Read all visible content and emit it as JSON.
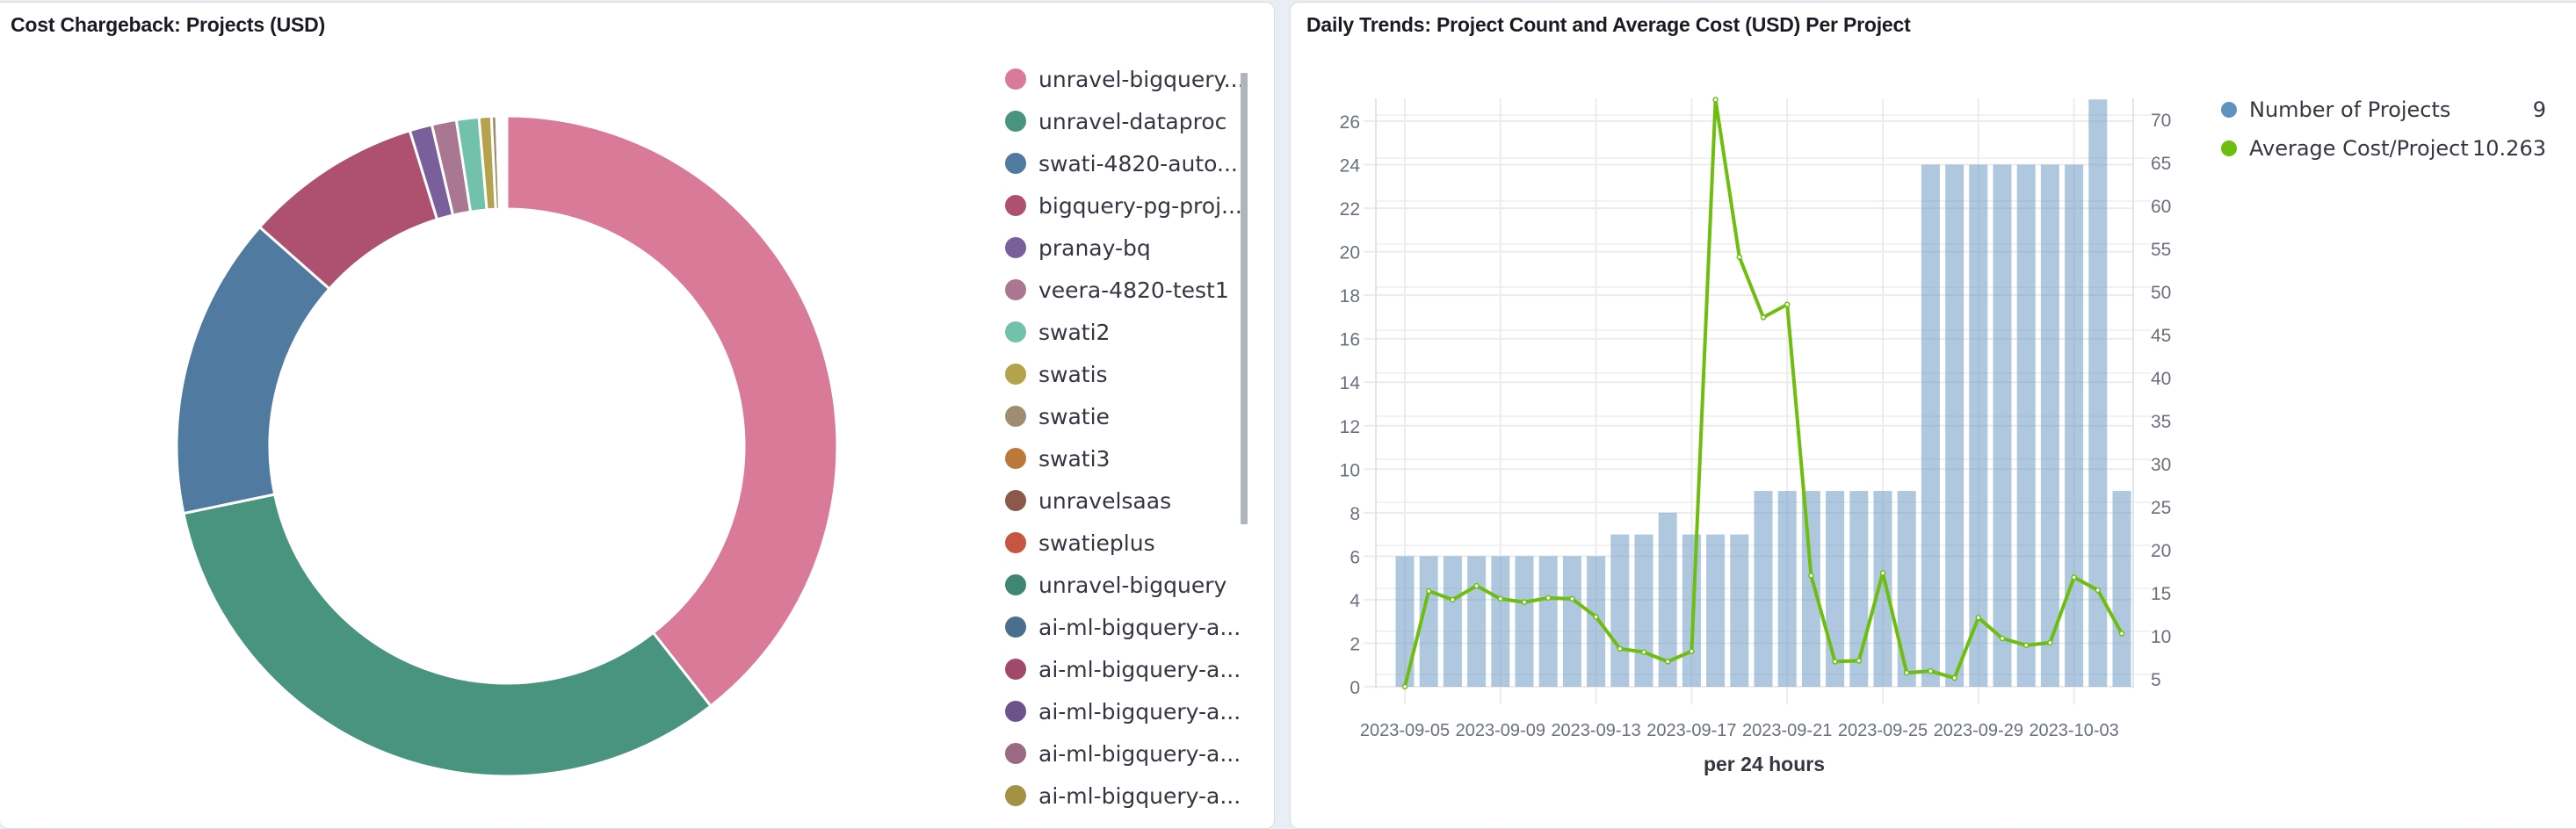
{
  "left_panel": {
    "title": "Cost Chargeback: Projects (USD)"
  },
  "right_panel": {
    "title": "Daily Trends: Project Count and Average Cost (USD) Per Project",
    "legend": [
      {
        "label": "Number of Projects",
        "value": "9",
        "color": "#6092c0"
      },
      {
        "label": "Average Cost/Project",
        "value": "10.263",
        "color": "#6dbe0e"
      }
    ]
  },
  "chart_data": [
    {
      "type": "pie",
      "variant": "donut",
      "title": "Cost Chargeback: Projects (USD)",
      "legend_placement": "right",
      "slices": [
        {
          "label": "unravel-bigquery...",
          "value": 39.4,
          "color": "#d97a98"
        },
        {
          "label": "unravel-dataproc",
          "value": 32.3,
          "color": "#48947f"
        },
        {
          "label": "swati-4820-auto...",
          "value": 14.8,
          "color": "#517aa0"
        },
        {
          "label": "bigquery-pg-proj...",
          "value": 8.7,
          "color": "#ae506f"
        },
        {
          "label": "pranay-bq",
          "value": 1.1,
          "color": "#7b5f9b"
        },
        {
          "label": "veera-4820-test1",
          "value": 1.2,
          "color": "#a97791"
        },
        {
          "label": "swati2",
          "value": 1.1,
          "color": "#72c1aa"
        },
        {
          "label": "swatis",
          "value": 0.6,
          "color": "#b5a24d"
        },
        {
          "label": "swatie",
          "value": 0.25,
          "color": "#a08c72"
        },
        {
          "label": "swati3",
          "value": 0.1,
          "color": "#bc773a"
        },
        {
          "label": "unravelsaas",
          "value": 0.05,
          "color": "#8b5849"
        },
        {
          "label": "swatieplus",
          "value": 0.05,
          "color": "#c65641"
        },
        {
          "label": "unravel-bigquery",
          "value": 0.05,
          "color": "#3f8772"
        },
        {
          "label": "ai-ml-bigquery-a...",
          "value": 0.05,
          "color": "#4a6e8e"
        },
        {
          "label": "ai-ml-bigquery-a...",
          "value": 0.05,
          "color": "#a24868"
        },
        {
          "label": "ai-ml-bigquery-a...",
          "value": 0.05,
          "color": "#6d528b"
        },
        {
          "label": "ai-ml-bigquery-a...",
          "value": 0.05,
          "color": "#9a6a82"
        },
        {
          "label": "ai-ml-bigquery-a...",
          "value": 0.05,
          "color": "#a49143"
        }
      ]
    },
    {
      "type": "bar+line",
      "title": "Daily Trends: Project Count and Average Cost (USD) Per Project",
      "xlabel": "per 24 hours",
      "x_tick_labels": [
        "2023-09-05",
        "2023-09-09",
        "2023-09-13",
        "2023-09-17",
        "2023-09-21",
        "2023-09-25",
        "2023-09-29",
        "2023-10-03"
      ],
      "x": [
        "2023-09-05",
        "2023-09-06",
        "2023-09-07",
        "2023-09-08",
        "2023-09-09",
        "2023-09-10",
        "2023-09-11",
        "2023-09-12",
        "2023-09-13",
        "2023-09-14",
        "2023-09-15",
        "2023-09-16",
        "2023-09-17",
        "2023-09-18",
        "2023-09-19",
        "2023-09-20",
        "2023-09-21",
        "2023-09-22",
        "2023-09-23",
        "2023-09-24",
        "2023-09-25",
        "2023-09-26",
        "2023-09-27",
        "2023-09-28",
        "2023-09-29",
        "2023-09-30",
        "2023-10-01",
        "2023-10-02",
        "2023-10-03",
        "2023-10-04",
        "2023-10-05"
      ],
      "y_left": {
        "ticks": [
          0,
          2,
          4,
          6,
          8,
          10,
          12,
          14,
          16,
          18,
          20,
          22,
          24,
          26
        ],
        "range": [
          0,
          27
        ]
      },
      "y_right": {
        "ticks": [
          5,
          10,
          15,
          20,
          25,
          30,
          35,
          40,
          45,
          50,
          55,
          60,
          65,
          70
        ],
        "range": [
          4.1,
          72.5
        ]
      },
      "grid": true,
      "legend_placement": "right",
      "series": [
        {
          "name": "Number of Projects",
          "type": "bar",
          "axis": "left",
          "color": "#6092c0",
          "values": [
            6,
            6,
            6,
            6,
            6,
            6,
            6,
            6,
            6,
            7,
            7,
            8,
            7,
            7,
            7,
            9,
            9,
            9,
            9,
            9,
            9,
            9,
            24,
            24,
            24,
            24,
            24,
            24,
            24,
            27,
            9
          ]
        },
        {
          "name": "Average Cost/Project",
          "type": "line",
          "axis": "right",
          "color": "#6dbe0e",
          "values": [
            4.1,
            15.2,
            14.2,
            15.8,
            14.3,
            13.9,
            14.4,
            14.3,
            12.2,
            8.5,
            8.1,
            7.0,
            8.2,
            72.3,
            54.0,
            47.0,
            48.5,
            17.0,
            7.0,
            7.1,
            17.3,
            5.7,
            5.9,
            5.1,
            12.1,
            9.7,
            8.9,
            9.2,
            16.8,
            15.3,
            10.263
          ]
        }
      ]
    }
  ]
}
